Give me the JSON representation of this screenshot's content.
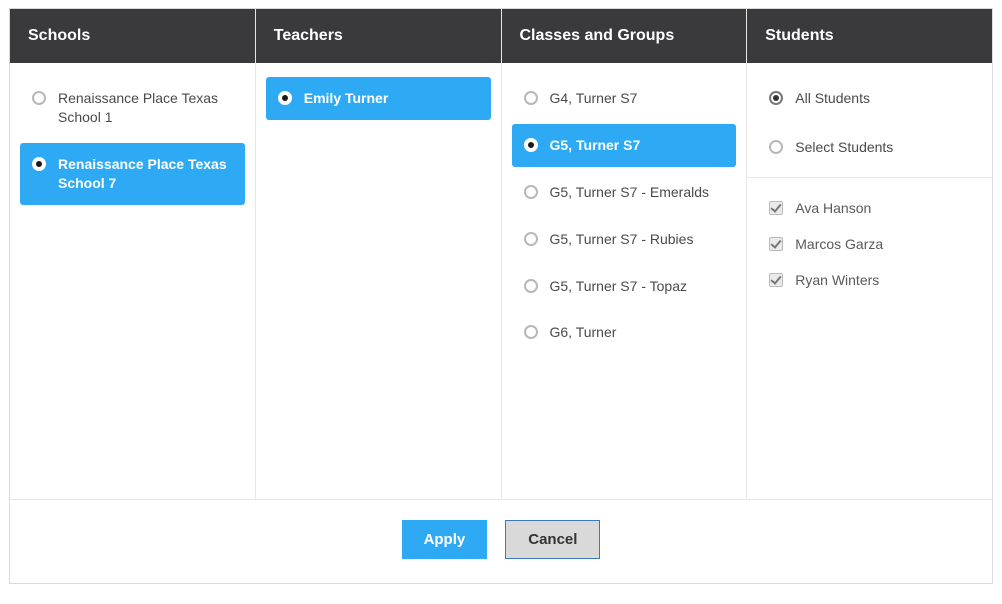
{
  "headers": {
    "schools": "Schools",
    "teachers": "Teachers",
    "classes": "Classes and Groups",
    "students": "Students"
  },
  "schools": [
    {
      "label": "Renaissance Place Texas School 1",
      "selected": false
    },
    {
      "label": "Renaissance Place Texas School 7",
      "selected": true
    }
  ],
  "teachers": [
    {
      "label": "Emily Turner",
      "selected": true
    }
  ],
  "classes": [
    {
      "label": "G4, Turner S7",
      "selected": false
    },
    {
      "label": "G5, Turner S7",
      "selected": true
    },
    {
      "label": "G5, Turner S7 - Emeralds",
      "selected": false
    },
    {
      "label": "G5, Turner S7 - Rubies",
      "selected": false
    },
    {
      "label": "G5, Turner S7 - Topaz",
      "selected": false
    },
    {
      "label": "G6, Turner",
      "selected": false
    }
  ],
  "student_mode": {
    "all": {
      "label": "All Students",
      "checked": true
    },
    "select": {
      "label": "Select Students",
      "checked": false
    }
  },
  "students": [
    {
      "label": "Ava Hanson",
      "checked": true
    },
    {
      "label": "Marcos Garza",
      "checked": true
    },
    {
      "label": "Ryan Winters",
      "checked": true
    }
  ],
  "buttons": {
    "apply": "Apply",
    "cancel": "Cancel"
  }
}
